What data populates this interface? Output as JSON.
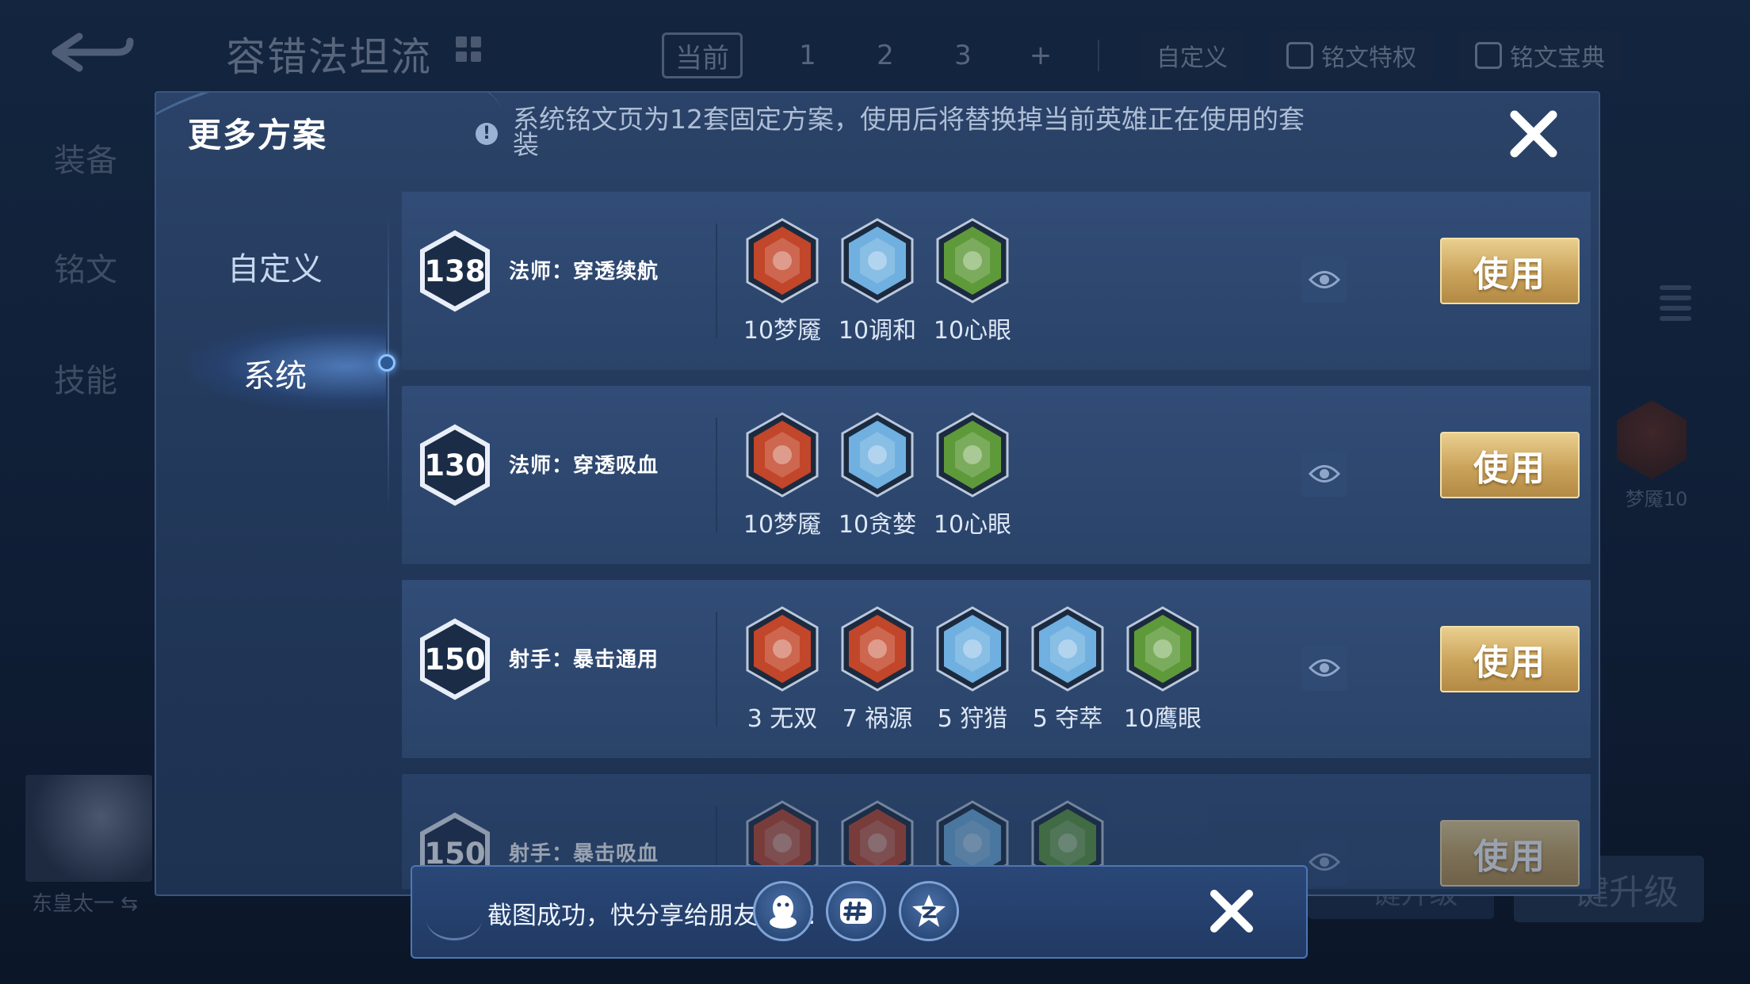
{
  "background": {
    "title": "容错法坦流",
    "tabs": [
      "当前",
      "1",
      "2",
      "3",
      "+"
    ],
    "buttons": {
      "custom": "自定义",
      "privilege": "铭文特权",
      "codex": "铭文宝典"
    },
    "left_menu": [
      "装备",
      "铭文",
      "技能"
    ],
    "hero_name": "东皇太一 ⇆",
    "side_rune_label": "梦魇10",
    "upgrade_label": "一键升级",
    "upgrade_label_2": "一键升级"
  },
  "modal": {
    "title": "更多方案",
    "notice": "系统铭文页为12套固定方案，使用后将替换掉当前英雄正在使用的套装",
    "sidebar": {
      "custom": "自定义",
      "system": "系统"
    }
  },
  "schemes": [
    {
      "level": "138",
      "name": "法师：穿透续航",
      "runes": [
        {
          "label": "10梦魇",
          "icon": "nightmare-rune-icon",
          "color": "#c2462a"
        },
        {
          "label": "10调和",
          "icon": "harmony-rune-icon",
          "color": "#6fb0e0"
        },
        {
          "label": "10心眼",
          "icon": "mind-eye-rune-icon",
          "color": "#5f9a3a"
        }
      ],
      "use_label": "使用"
    },
    {
      "level": "130",
      "name": "法师：穿透吸血",
      "runes": [
        {
          "label": "10梦魇",
          "icon": "nightmare-rune-icon",
          "color": "#c2462a"
        },
        {
          "label": "10贪婪",
          "icon": "greed-rune-icon",
          "color": "#6fb0e0"
        },
        {
          "label": "10心眼",
          "icon": "mind-eye-rune-icon",
          "color": "#5f9a3a"
        }
      ],
      "use_label": "使用"
    },
    {
      "level": "150",
      "name": "射手：暴击通用",
      "runes": [
        {
          "label": "3 无双",
          "icon": "peerless-rune-icon",
          "color": "#c2462a"
        },
        {
          "label": "7 祸源",
          "icon": "calamity-rune-icon",
          "color": "#c2462a"
        },
        {
          "label": "5 狩猎",
          "icon": "hunt-rune-icon",
          "color": "#6fb0e0"
        },
        {
          "label": "5 夺萃",
          "icon": "plunder-rune-icon",
          "color": "#6fb0e0"
        },
        {
          "label": "10鹰眼",
          "icon": "hawk-eye-rune-icon",
          "color": "#5f9a3a"
        }
      ],
      "use_label": "使用"
    },
    {
      "level": "150",
      "name": "射手：暴击吸血",
      "runes": [
        {
          "label": "",
          "icon": "peerless-rune-icon",
          "color": "#c2462a"
        },
        {
          "label": "",
          "icon": "calamity-rune-icon",
          "color": "#c2462a"
        },
        {
          "label": "",
          "icon": "plunder-rune-icon",
          "color": "#6fb0e0"
        },
        {
          "label": "",
          "icon": "hawk-eye-rune-icon",
          "color": "#5f9a3a"
        }
      ],
      "use_label": "使用"
    }
  ],
  "toast": {
    "text": "截图成功，快分享给朋友们吧!",
    "share_targets": [
      "qq-icon",
      "wechat-moments-icon",
      "qzone-icon"
    ]
  }
}
